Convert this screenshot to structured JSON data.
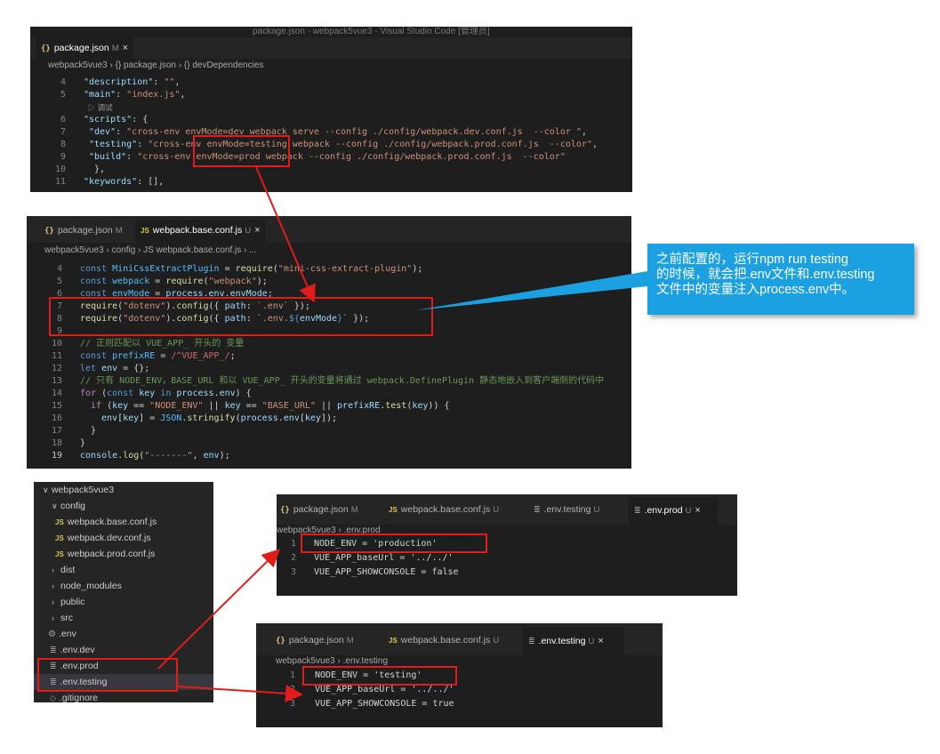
{
  "panel1": {
    "title": "package.json - webpack5vue3 - Visual Studio Code [管理员]",
    "tab": {
      "label": "package.json",
      "badge": "M",
      "close": "×"
    },
    "breadcrumb": "webpack5vue3 › {} package.json › {} devDependencies",
    "lines": [
      {
        "n": "4",
        "t": "  \"description\": \"\","
      },
      {
        "n": "5",
        "t": "  \"main\": \"index.js\","
      },
      {
        "n": "",
        "t": "  ▷ 调试"
      },
      {
        "n": "6",
        "t": "  \"scripts\": {"
      },
      {
        "n": "7",
        "t": "    \"dev\": \"cross-env envMode=dev webpack serve --config ./config/webpack.dev.conf.js  --color \","
      },
      {
        "n": "8",
        "t": "    \"testing\": \"cross-env envMode=testing webpack --config ./config/webpack.prod.conf.js  --color\","
      },
      {
        "n": "9",
        "t": "    \"build\": \"cross-env envMode=prod webpack --config ./config/webpack.prod.conf.js  --color\""
      },
      {
        "n": "10",
        "t": "  },"
      },
      {
        "n": "11",
        "t": "  \"keywords\": [],"
      }
    ]
  },
  "panel2": {
    "tabs": [
      {
        "label": "package.json",
        "badge": "M",
        "close": ""
      },
      {
        "label": "webpack.base.conf.js",
        "badge": "U",
        "close": "×"
      }
    ],
    "breadcrumb": "webpack5vue3 › config › JS webpack.base.conf.js › ...",
    "lines": [
      {
        "n": "4",
        "t": "const MiniCssExtractPlugin = require(\"mini-css-extract-plugin\");"
      },
      {
        "n": "5",
        "t": "const webpack = require(\"webpack\");"
      },
      {
        "n": "6",
        "t": "const envMode = process.env.envMode;"
      },
      {
        "n": "7",
        "t": "require(\"dotenv\").config({ path: `.env` });"
      },
      {
        "n": "8",
        "t": "require(\"dotenv\").config({ path: `.env.${envMode}` });"
      },
      {
        "n": "9",
        "t": ""
      },
      {
        "n": "10",
        "t": "// 正则匹配以 VUE_APP_ 开头的 变量"
      },
      {
        "n": "11",
        "t": "const prefixRE = /^VUE_APP_/;"
      },
      {
        "n": "12",
        "t": "let env = {};"
      },
      {
        "n": "13",
        "t": "// 只有 NODE_ENV，BASE_URL 和以 VUE_APP_ 开头的变量将通过 webpack.DefinePlugin 静态地嵌入到客户端侧的代码中"
      },
      {
        "n": "14",
        "t": "for (const key in process.env) {"
      },
      {
        "n": "15",
        "t": "  if (key == \"NODE_ENV\" || key == \"BASE_URL\" || prefixRE.test(key)) {"
      },
      {
        "n": "16",
        "t": "    env[key] = JSON.stringify(process.env[key]);"
      },
      {
        "n": "17",
        "t": "  }"
      },
      {
        "n": "18",
        "t": "}"
      },
      {
        "n": "19",
        "t": "console.log(\"-------\", env);"
      }
    ]
  },
  "callout": {
    "line1": "之前配置的，运行npm run testing",
    "line2": "的时候，就会把.env文件和.env.testing",
    "line3": "文件中的变量注入process.env中。"
  },
  "tree": {
    "items": [
      {
        "label": "webpack5vue3",
        "type": "folder-open",
        "depth": 0
      },
      {
        "label": "config",
        "type": "folder-open",
        "depth": 1
      },
      {
        "label": "webpack.base.conf.js",
        "type": "js",
        "depth": 2
      },
      {
        "label": "webpack.dev.conf.js",
        "type": "js",
        "depth": 2
      },
      {
        "label": "webpack.prod.conf.js",
        "type": "js",
        "depth": 2
      },
      {
        "label": "dist",
        "type": "folder",
        "depth": 1
      },
      {
        "label": "node_modules",
        "type": "folder",
        "depth": 1
      },
      {
        "label": "public",
        "type": "folder",
        "depth": 1
      },
      {
        "label": "src",
        "type": "folder",
        "depth": 1
      },
      {
        "label": ".env",
        "type": "gear",
        "depth": 1
      },
      {
        "label": ".env.dev",
        "type": "file",
        "depth": 1
      },
      {
        "label": ".env.prod",
        "type": "file",
        "depth": 1
      },
      {
        "label": ".env.testing",
        "type": "file",
        "depth": 1
      },
      {
        "label": ".gitignore",
        "type": "file",
        "depth": 1
      }
    ]
  },
  "panel3": {
    "tabs": [
      {
        "label": "package.json",
        "badge": "M"
      },
      {
        "label": "webpack.base.conf.js",
        "badge": "U"
      },
      {
        "label": ".env.testing",
        "badge": "U"
      },
      {
        "label": ".env.prod",
        "badge": "U",
        "close": "×"
      }
    ],
    "breadcrumb": "webpack5vue3 › .env.prod",
    "lines": [
      {
        "n": "1",
        "t": "NODE_ENV = 'production'"
      },
      {
        "n": "2",
        "t": "VUE_APP_baseUrl = '../../'"
      },
      {
        "n": "3",
        "t": "VUE_APP_SHOWCONSOLE = false"
      }
    ]
  },
  "panel4": {
    "tabs": [
      {
        "label": "package.json",
        "badge": "M"
      },
      {
        "label": "webpack.base.conf.js",
        "badge": "U"
      },
      {
        "label": ".env.testing",
        "badge": "U",
        "close": "×"
      }
    ],
    "breadcrumb": "webpack5vue3 › .env.testing",
    "lines": [
      {
        "n": "1",
        "t": "NODE_ENV = 'testing'"
      },
      {
        "n": "2",
        "t": "VUE_APP_baseUrl = '../../'"
      },
      {
        "n": "3",
        "t": "VUE_APP_SHOWCONSOLE = true"
      }
    ]
  },
  "colors": {
    "annotation": "#e21b1b",
    "callout": "#1ba1e2",
    "editor_bg": "#1e1e1e",
    "tabbar_bg": "#252526"
  }
}
